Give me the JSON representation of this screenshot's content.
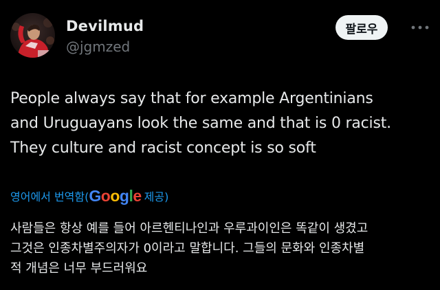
{
  "author": {
    "display_name": "Devilmud",
    "handle": "@jgmzed",
    "avatar_icon": "profile-photo-avatar"
  },
  "actions": {
    "follow_label": "팔로우",
    "more_icon": "more-horizontal-icon"
  },
  "tweet": {
    "lines": [
      "People always say that for example Argentinians",
      "and Uruguayans look the same and that is 0 racist.",
      "They culture and racist concept is so soft"
    ]
  },
  "translation": {
    "prefix": "영어에서 번역함(",
    "provider": "Google",
    "suffix": " 제공)",
    "lines": [
      "사람들은 항상 예를 들어 아르헨티나인과 우루과이인은 똑같이 생겼고",
      "그것은 인종차별주의자가 0이라고 말합니다. 그들의 문화와 인종차별",
      "적 개념은 너무 부드러워요"
    ]
  },
  "colors": {
    "background": "#000000",
    "text_primary": "#e7e9ea",
    "text_secondary": "#71767b",
    "link_blue": "#1d9bf0",
    "follow_bg": "#eff3f4",
    "google_blue": "#4285f4",
    "google_red": "#ea4335",
    "google_yellow": "#fbbc05",
    "google_green": "#34a853"
  }
}
